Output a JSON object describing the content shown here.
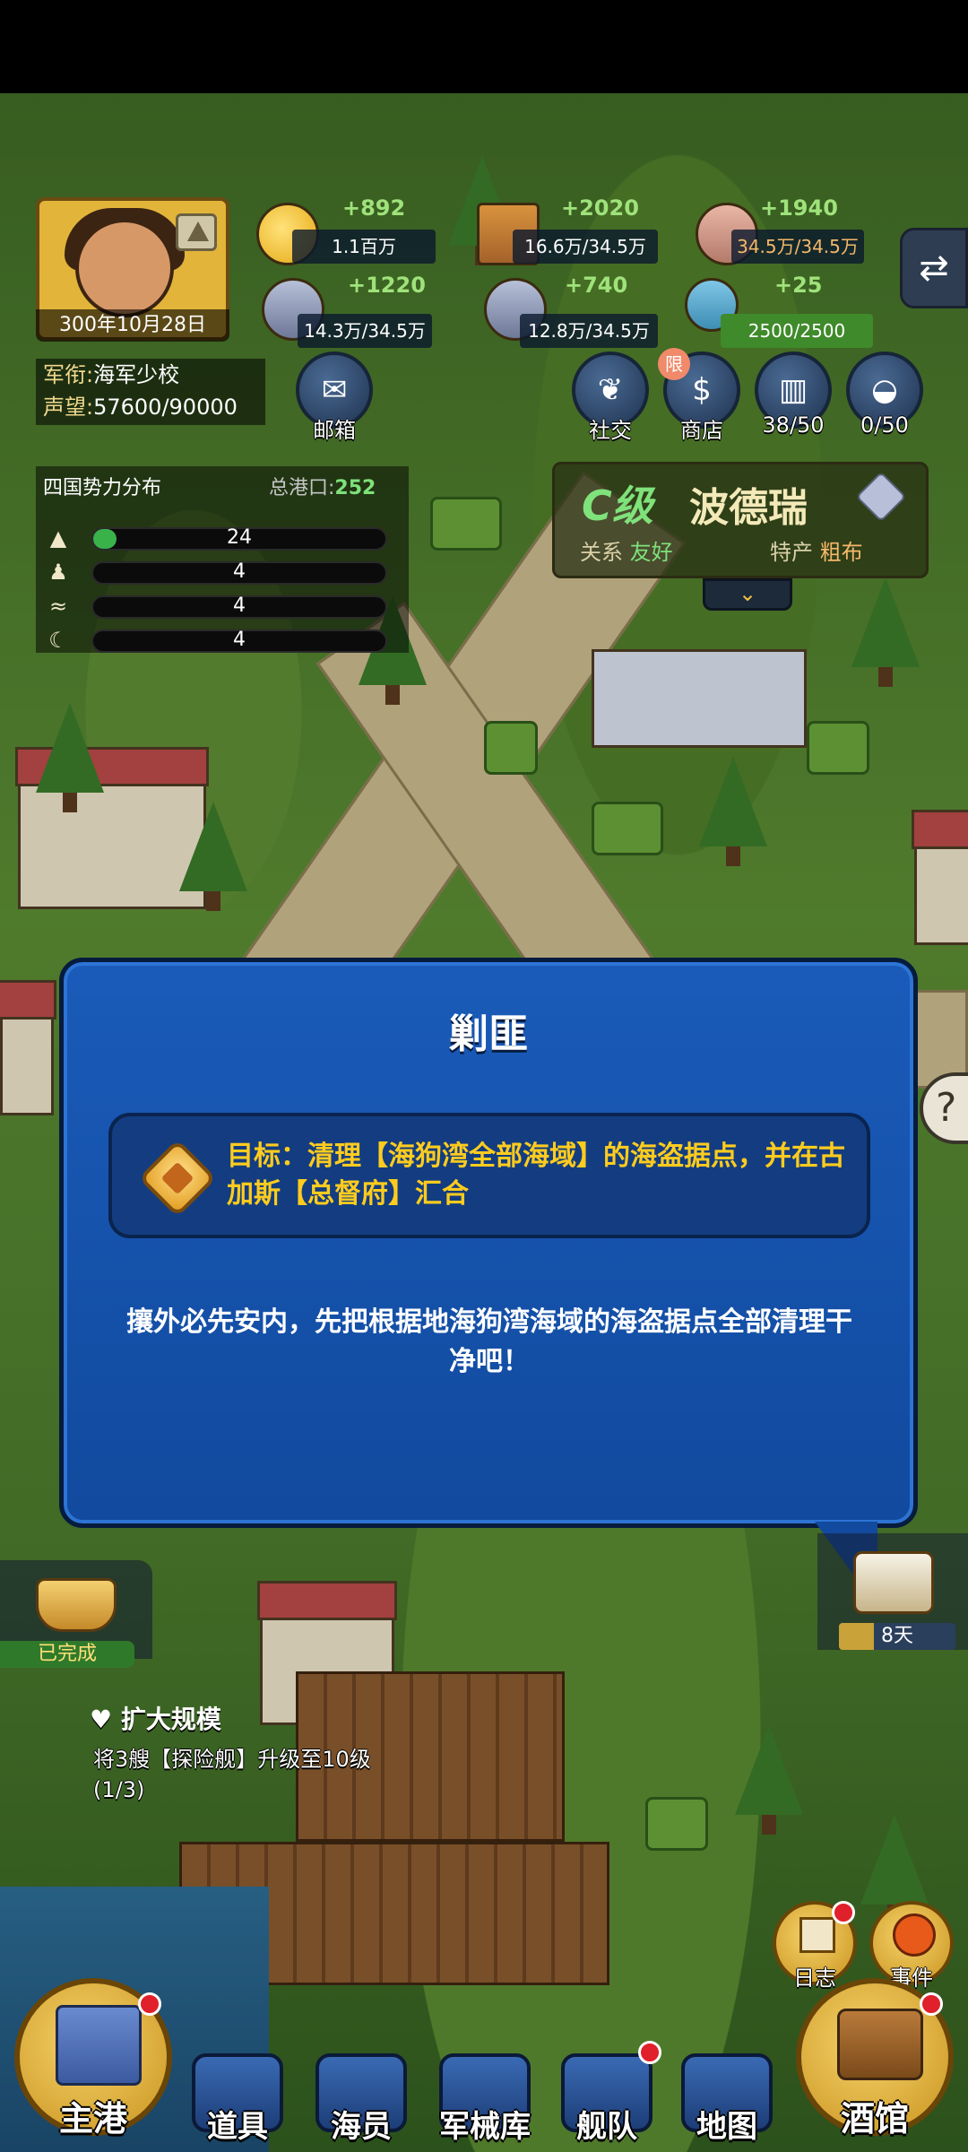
{
  "player": {
    "date": "300年10月28日",
    "rank_label": "军衔:",
    "rank_value": "海军少校",
    "fame_label": "声望:",
    "fame_value": "57600/90000"
  },
  "resources": {
    "gold": {
      "delta": "+892",
      "amount": "1.1百万"
    },
    "wood": {
      "delta": "+2020",
      "amount": "16.6万/34.5万"
    },
    "stone": {
      "delta": "+1940",
      "amount": "34.5万/34.5万"
    },
    "iron": {
      "delta": "+1220",
      "amount": "14.3万/34.5万"
    },
    "steel": {
      "delta": "+740",
      "amount": "12.8万/34.5万"
    },
    "crew": {
      "delta": "+25",
      "amount": "2500/2500"
    }
  },
  "side_buttons": {
    "mailbox": "邮箱",
    "social": "社交",
    "shop": "商店",
    "shop_badge": "限",
    "book": "38/50",
    "bag": "0/50"
  },
  "powers": {
    "title": "四国势力分布",
    "port_label": "总港口:",
    "port_value": "252",
    "rows": [
      {
        "symbol": "▲",
        "value": "24",
        "fill": 0.08
      },
      {
        "symbol": "♟",
        "value": "4",
        "fill": 0
      },
      {
        "symbol": "≈",
        "value": "4",
        "fill": 0
      },
      {
        "symbol": "☾",
        "value": "4",
        "fill": 0
      }
    ]
  },
  "city": {
    "grade": "C级",
    "name": "波德瑞",
    "relation_label": "关系",
    "relation_value": "友好",
    "specialty_label": "特产",
    "specialty_value": "粗布",
    "expand_icon": "chevron-down-icon"
  },
  "dialog": {
    "title": "剿匪",
    "goal": "目标：清理【海狗湾全部海域】的海盗据点，并在古加斯【总督府】汇合",
    "description": "攘外必先安内，先把根据地海狗湾海域的海盗据点全部清理干净吧！"
  },
  "quest": {
    "done": "已完成",
    "title": "扩大规模",
    "description": "将3艘【探险舰】升级至10级(1/3)"
  },
  "voyage": {
    "days": "8天",
    "progress": 0.3
  },
  "corner": {
    "log": "日志",
    "events": "事件"
  },
  "nav": {
    "home": "主港",
    "items": "道具",
    "crew": "海员",
    "armory": "军械库",
    "fleet": "舰队",
    "map": "地图",
    "tavern": "酒馆"
  },
  "colors": {
    "dialog_blue": "#1a5bb9",
    "goal_yellow": "#ffcc1e",
    "positive_green": "#7fe27b"
  }
}
